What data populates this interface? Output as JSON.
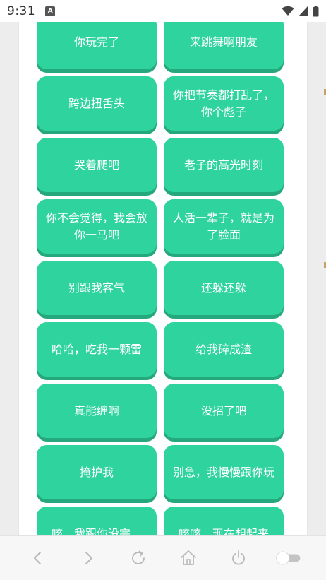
{
  "status_bar": {
    "time": "9:31",
    "notification_letter": "A"
  },
  "phrases": [
    "你玩完了",
    "来跳舞啊朋友",
    "跨边扭舌头",
    "你把节奏都打乱了，你个彪子",
    "哭着爬吧",
    "老子的高光时刻",
    "你不会觉得，我会放你一马吧",
    "人活一辈子，就是为了脸面",
    "别跟我客气",
    "还躲还躲",
    "哈哈，吃我一颗雷",
    "给我碎成渣",
    "真能缠啊",
    "没招了吧",
    "掩护我",
    "别急，我慢慢跟你玩",
    "咳，我跟你没完，",
    "咳咳，现在想起来"
  ],
  "colors": {
    "button": "#2fd39d",
    "button_shadow": "#25a87c",
    "nav_icon": "#b9b9b9"
  },
  "nav_icons": [
    "back-icon",
    "forward-icon",
    "refresh-icon",
    "home-icon",
    "power-icon",
    "toggle-switch"
  ]
}
